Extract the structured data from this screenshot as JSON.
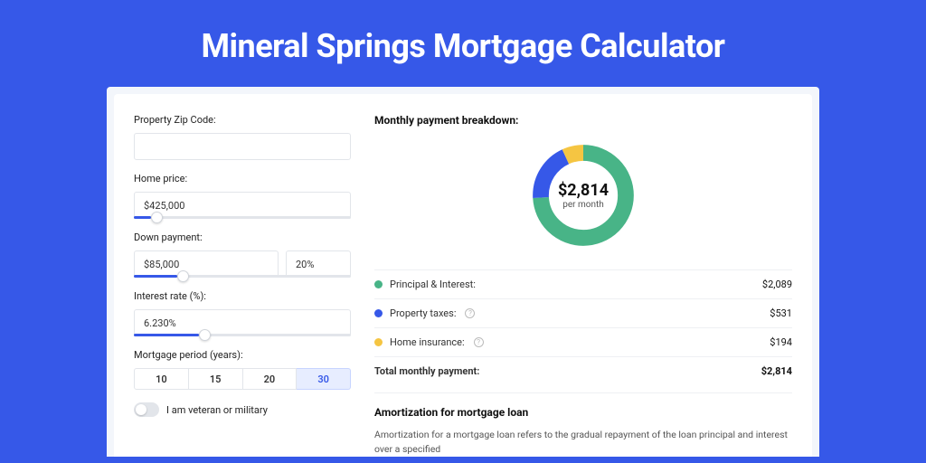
{
  "title": "Mineral Springs Mortgage Calculator",
  "colors": {
    "green": "#48b487",
    "blue": "#3658e8",
    "yellow": "#f5c542"
  },
  "form": {
    "zip_label": "Property Zip Code:",
    "zip_value": "",
    "home_price_label": "Home price:",
    "home_price_value": "$425,000",
    "home_price_slider_pct": 8,
    "down_payment_label": "Down payment:",
    "down_payment_value": "$85,000",
    "down_payment_pct_value": "20%",
    "down_payment_slider_pct": 20,
    "interest_label": "Interest rate (%):",
    "interest_value": "6.230%",
    "interest_slider_pct": 30,
    "period_label": "Mortgage period (years):",
    "period_options": [
      "10",
      "15",
      "20",
      "30"
    ],
    "period_selected": "30",
    "veteran_label": "I am veteran or military"
  },
  "breakdown": {
    "title": "Monthly payment breakdown:",
    "total_amount": "$2,814",
    "total_sub": "per month",
    "items": [
      {
        "key": "pi",
        "label": "Principal & Interest:",
        "value": "$2,089",
        "color": "#48b487",
        "info": false,
        "pct": 74
      },
      {
        "key": "tax",
        "label": "Property taxes:",
        "value": "$531",
        "color": "#3658e8",
        "info": true,
        "pct": 19
      },
      {
        "key": "ins",
        "label": "Home insurance:",
        "value": "$194",
        "color": "#f5c542",
        "info": true,
        "pct": 7
      }
    ],
    "total_label": "Total monthly payment:",
    "total_value": "$2,814"
  },
  "amort": {
    "title": "Amortization for mortgage loan",
    "text": "Amortization for a mortgage loan refers to the gradual repayment of the loan principal and interest over a specified"
  },
  "chart_data": {
    "type": "pie",
    "title": "Monthly payment breakdown",
    "series": [
      {
        "name": "Principal & Interest",
        "value": 2089,
        "color": "#48b487"
      },
      {
        "name": "Property taxes",
        "value": 531,
        "color": "#3658e8"
      },
      {
        "name": "Home insurance",
        "value": 194,
        "color": "#f5c542"
      }
    ],
    "total": 2814,
    "unit": "USD per month"
  }
}
